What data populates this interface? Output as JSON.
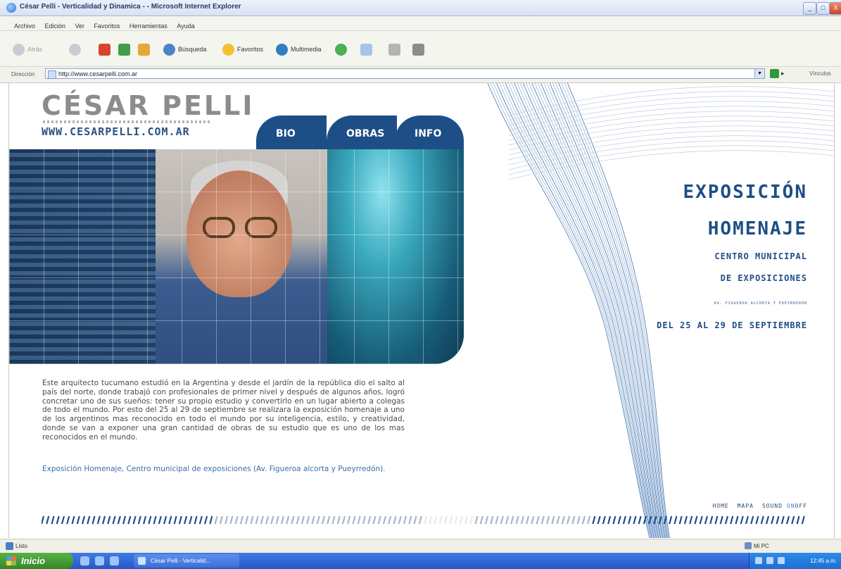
{
  "window": {
    "title": "César Pelli - Verticalidad y Dinamica - - Microsoft Internet Explorer",
    "controls": [
      "_",
      "□",
      "X"
    ]
  },
  "menu": [
    "Archivo",
    "Edición",
    "Ver",
    "Favoritos",
    "Herramientas",
    "Ayuda"
  ],
  "toolbar": {
    "back": "Atrás",
    "search": "Búsqueda",
    "favorites": "Favoritos",
    "multimedia": "Multimedia"
  },
  "address": {
    "label": "Dirección",
    "url": "http://www.cesarpelli.com.ar",
    "links": "Vínculos"
  },
  "site": {
    "logo_name": "CÉSAR PELLI",
    "logo_url": "WWW.CESARPELLI.COM.AR",
    "nav": [
      "BIO",
      "OBRAS",
      "INFO"
    ],
    "body_text": "Este arquitecto tucumano estudió en la Argentina y desde el jardín de la república dio el salto al país del norte, donde trabajó con profesionales de primer nivel y después de algunos años, logró concretar uno de sus sueños: tener su propio estudio y convertirlo en un lugar abierto a colegas de todo el mundo. Por esto del 25 al 29 de septiembre se realizara la exposición homenaje a uno de los argentinos mas reconocido en todo el mundo por su inteligencia, estilo, y creatividad, donde se van a exponer una gran cantidad de obras de su estudio que es uno de los mas reconocidos en el mundo.",
    "body_link": "Exposición Homenaje, Centro municipal de exposiciones (Av. Figueroa alcorta y Pueyrredón).",
    "expo": {
      "title1": "EXPOSICIÓN",
      "title2": "HOMENAJE",
      "sub1": "CENTRO MUNICIPAL",
      "sub2": "DE EXPOSICIONES",
      "address": "AV. FIGUEROA ALCORTA Y PUEYRREDÓN",
      "dates": "DEL 25 AL 29 DE SEPTIEMBRE"
    },
    "footer": {
      "home": "HOME",
      "mapa": "MAPA",
      "sound": "SOUND",
      "on": "ON",
      "off": "OFF"
    }
  },
  "status": {
    "text": "Listo",
    "zone": "Mi PC"
  },
  "taskbar": {
    "start": "Inicio",
    "item": "César Pelli - Verticalid...",
    "clock": "12:45 a.m."
  },
  "colors": {
    "brand_blue": "#1e4e86",
    "link_blue": "#3a6fa8",
    "logo_gray": "#8c8c8c"
  }
}
